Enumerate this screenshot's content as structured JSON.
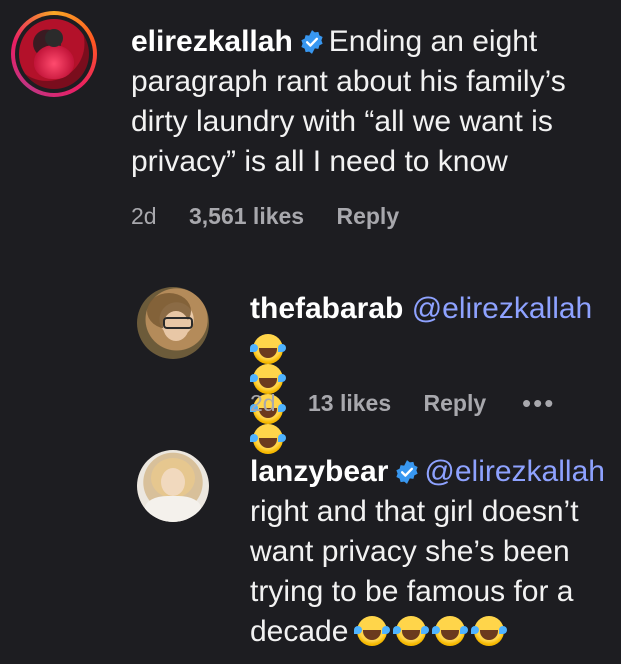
{
  "comments": [
    {
      "username": "elirezkallah",
      "verified": true,
      "text": "Ending an eight paragraph rant about his family’s dirty laundry with “all we want is privacy” is all I need to know",
      "time": "2d",
      "likes": "3,561 likes",
      "reply_label": "Reply"
    },
    {
      "username": "thefabarab",
      "verified": false,
      "mention": "@elirezkallah",
      "emoji_count": 4,
      "emoji_name": "face-with-tears-of-joy",
      "time": "2d",
      "likes": "13 likes",
      "reply_label": "Reply",
      "more_label": "•••"
    },
    {
      "username": "lanzybear",
      "verified": true,
      "mention": "@elirezkallah",
      "text": "right and that girl doesn’t want privacy she’s been trying to be famous for a decade",
      "emoji_count": 4,
      "emoji_name": "face-with-tears-of-joy"
    }
  ],
  "colors": {
    "background": "#1d1d21",
    "mention": "#8ea2ff",
    "verified": "#3897f0",
    "meta": "#a8a8ad"
  }
}
